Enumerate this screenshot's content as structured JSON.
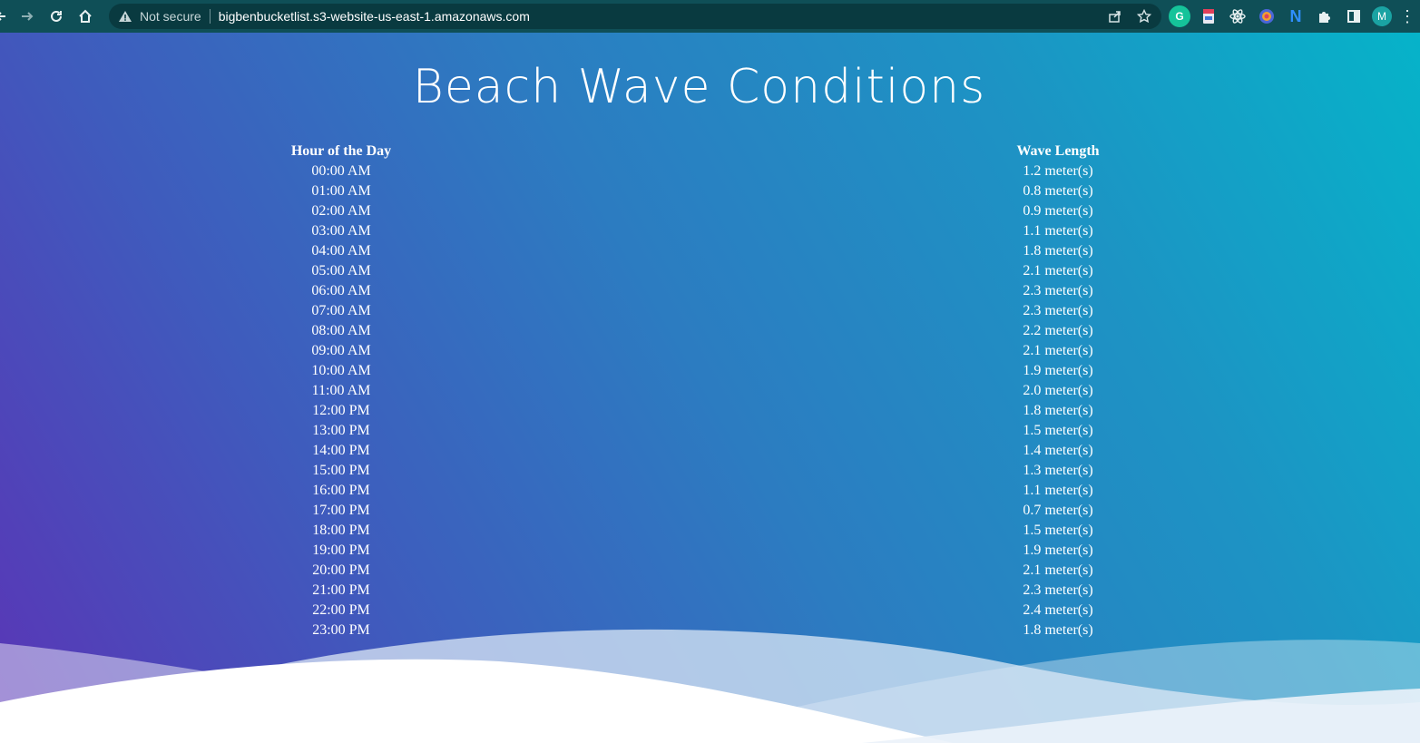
{
  "browser": {
    "security_label": "Not secure",
    "url": "bigbenbucketlist.s3-website-us-east-1.amazonaws.com",
    "profile_initial": "M",
    "extensions": [
      "grammarly-icon",
      "bookmark-ext-icon",
      "react-devtools-icon",
      "colorful-ext-icon",
      "n-ext-icon",
      "puzzle-icon"
    ]
  },
  "page": {
    "title": "Beach Wave Conditions"
  },
  "table": {
    "headers": [
      "Hour of the Day",
      "Wave Length"
    ],
    "rows": [
      {
        "hour": "00:00 AM",
        "wave": "1.2 meter(s)"
      },
      {
        "hour": "01:00 AM",
        "wave": "0.8 meter(s)"
      },
      {
        "hour": "02:00 AM",
        "wave": "0.9 meter(s)"
      },
      {
        "hour": "03:00 AM",
        "wave": "1.1 meter(s)"
      },
      {
        "hour": "04:00 AM",
        "wave": "1.8 meter(s)"
      },
      {
        "hour": "05:00 AM",
        "wave": "2.1 meter(s)"
      },
      {
        "hour": "06:00 AM",
        "wave": "2.3 meter(s)"
      },
      {
        "hour": "07:00 AM",
        "wave": "2.3 meter(s)"
      },
      {
        "hour": "08:00 AM",
        "wave": "2.2 meter(s)"
      },
      {
        "hour": "09:00 AM",
        "wave": "2.1 meter(s)"
      },
      {
        "hour": "10:00 AM",
        "wave": "1.9 meter(s)"
      },
      {
        "hour": "11:00 AM",
        "wave": "2.0 meter(s)"
      },
      {
        "hour": "12:00 PM",
        "wave": "1.8 meter(s)"
      },
      {
        "hour": "13:00 PM",
        "wave": "1.5 meter(s)"
      },
      {
        "hour": "14:00 PM",
        "wave": "1.4 meter(s)"
      },
      {
        "hour": "15:00 PM",
        "wave": "1.3 meter(s)"
      },
      {
        "hour": "16:00 PM",
        "wave": "1.1 meter(s)"
      },
      {
        "hour": "17:00 PM",
        "wave": "0.7 meter(s)"
      },
      {
        "hour": "18:00 PM",
        "wave": "1.5 meter(s)"
      },
      {
        "hour": "19:00 PM",
        "wave": "1.9 meter(s)"
      },
      {
        "hour": "20:00 PM",
        "wave": "2.1 meter(s)"
      },
      {
        "hour": "21:00 PM",
        "wave": "2.3 meter(s)"
      },
      {
        "hour": "22:00 PM",
        "wave": "2.4 meter(s)"
      },
      {
        "hour": "23:00 PM",
        "wave": "1.8 meter(s)"
      }
    ]
  },
  "colors": {
    "toolbar": "#0f4f57",
    "gradient_start": "#5a35b6",
    "gradient_end": "#06b3c9",
    "text": "#ffffff"
  }
}
